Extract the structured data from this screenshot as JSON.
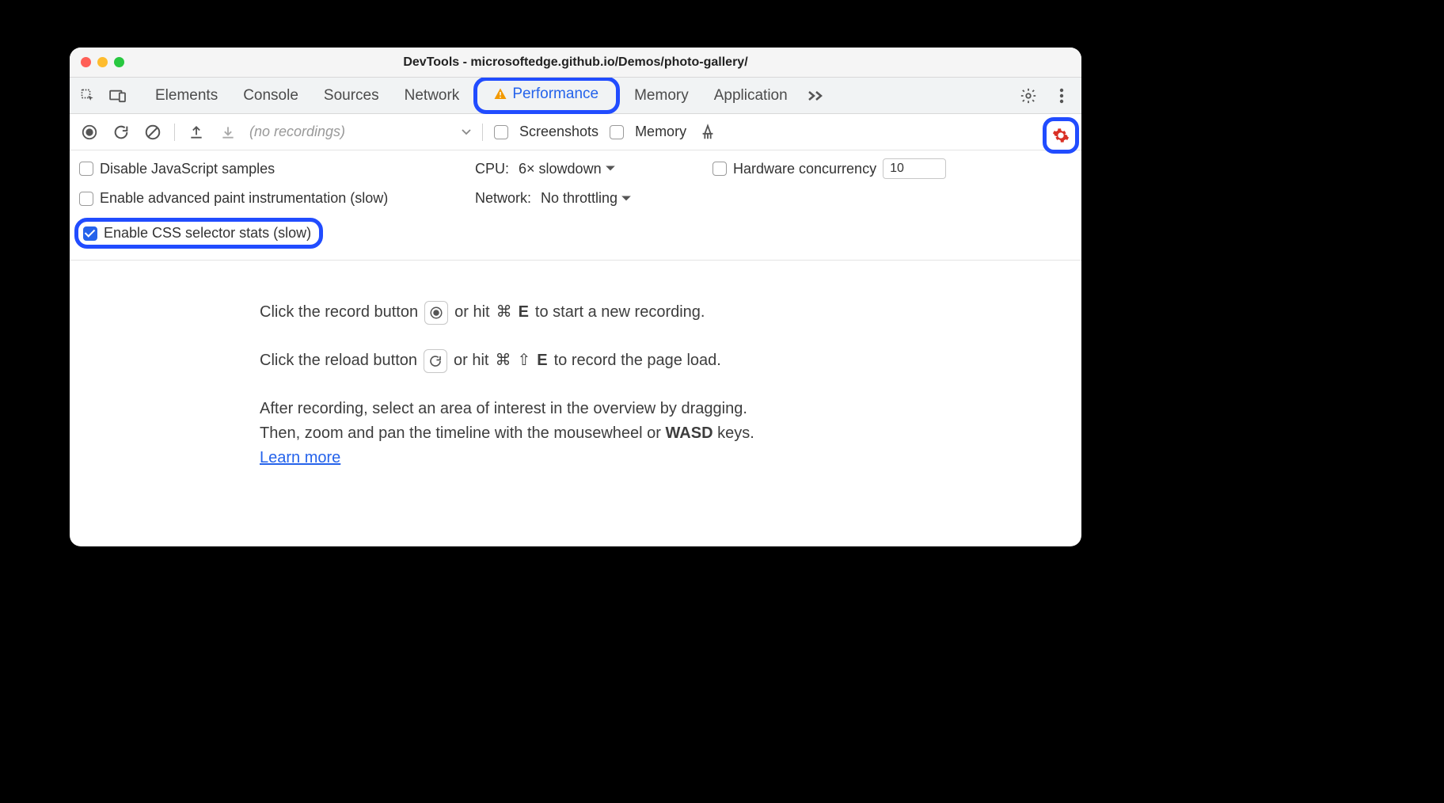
{
  "window": {
    "title": "DevTools - microsoftedge.github.io/Demos/photo-gallery/"
  },
  "tabs": {
    "elements": "Elements",
    "console": "Console",
    "sources": "Sources",
    "network": "Network",
    "performance": "Performance",
    "memory": "Memory",
    "application": "Application"
  },
  "toolbar": {
    "recordings_placeholder": "(no recordings)",
    "screenshots": "Screenshots",
    "memory": "Memory"
  },
  "settings": {
    "disable_js": "Disable JavaScript samples",
    "cpu_label": "CPU:",
    "cpu_value": "6× slowdown",
    "hw_label": "Hardware concurrency",
    "hw_value": "10",
    "paint": "Enable advanced paint instrumentation (slow)",
    "net_label": "Network:",
    "net_value": "No throttling",
    "css_stats": "Enable CSS selector stats (slow)"
  },
  "hints": {
    "rec1a": "Click the record button",
    "rec1b": "or hit",
    "rec1_kbd": "⌘",
    "rec1_key": "E",
    "rec1c": "to start a new recording.",
    "rec2a": "Click the reload button",
    "rec2b": "or hit",
    "rec2_kbd1": "⌘",
    "rec2_kbd2": "⇧",
    "rec2_key": "E",
    "rec2c": "to record the page load.",
    "p3a": "After recording, select an area of interest in the overview by dragging.",
    "p3b": "Then, zoom and pan the timeline with the mousewheel or ",
    "wasd": "WASD",
    "p3c": " keys.",
    "learn": "Learn more"
  }
}
